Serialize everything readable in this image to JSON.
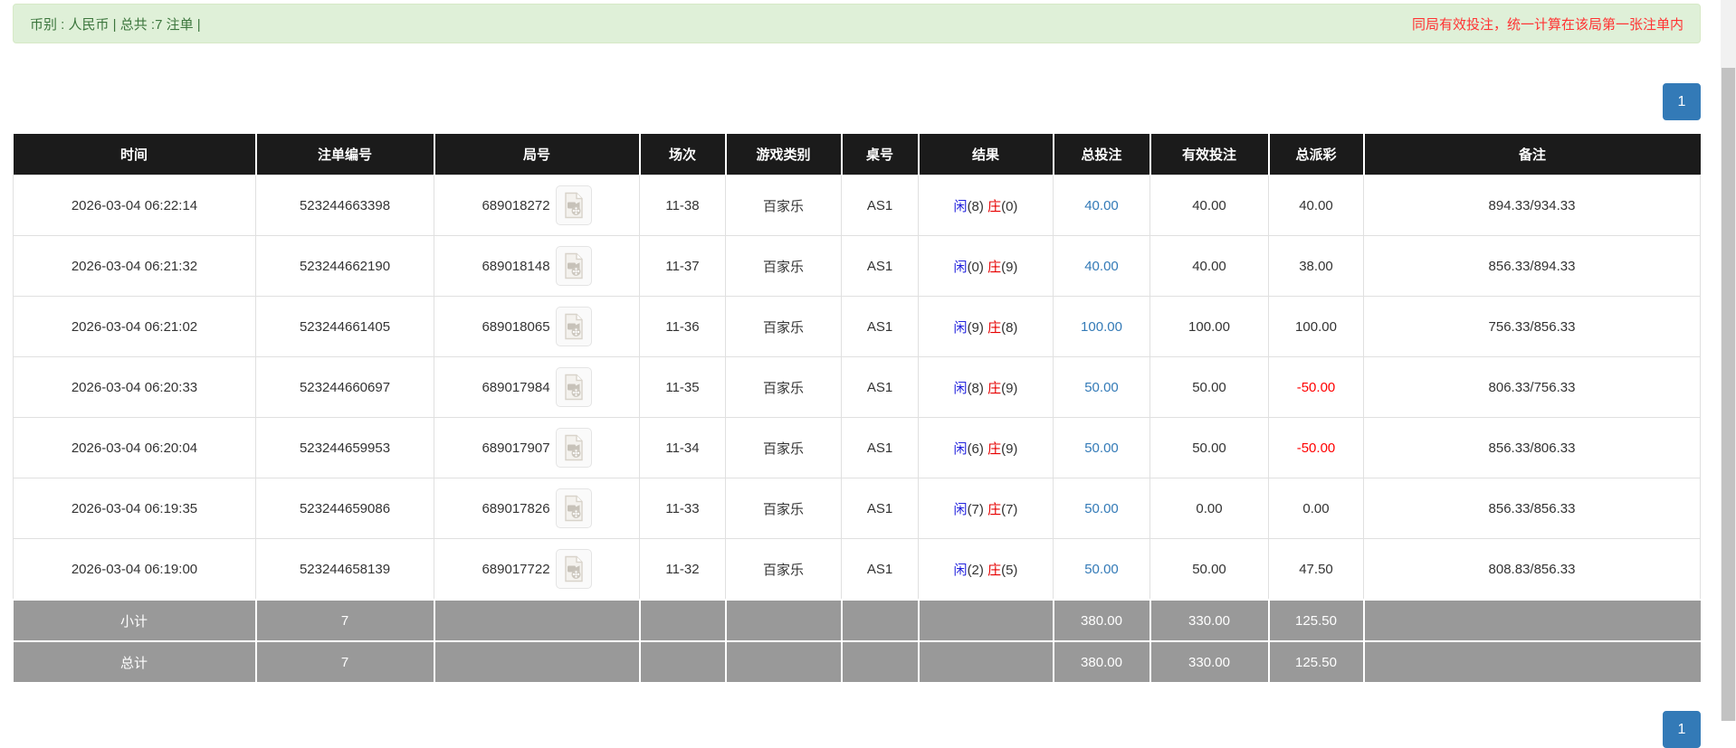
{
  "top_bar": {
    "summary": "币别 : 人民币 | 总共 :7 注单 |",
    "notice": "同局有效投注，统一计算在该局第一张注单内"
  },
  "pagination": {
    "page": "1"
  },
  "colors": {
    "accent_blue": "#337ab7",
    "player_blue": "#2323dd",
    "banker_red": "#e60000",
    "negative_red": "#ff0000",
    "header_bg": "#1b1b1b",
    "footer_bg": "#999999",
    "alert_bg": "#dff0d8",
    "alert_text": "#3c763d",
    "notice_red": "#ff3333"
  },
  "table": {
    "headers": [
      "时间",
      "注单编号",
      "局号",
      "场次",
      "游戏类别",
      "桌号",
      "结果",
      "总投注",
      "有效投注",
      "总派彩",
      "备注"
    ],
    "player_label": "闲",
    "banker_label": "庄",
    "video_icon": "video-document-icon",
    "rows": [
      {
        "time": "2026-03-04 06:22:14",
        "bet_id": "523244663398",
        "round": "689018272",
        "session": "11-38",
        "game": "百家乐",
        "table_no": "AS1",
        "player": "(8)",
        "banker": "(0)",
        "total_bet": "40.00",
        "valid_bet": "40.00",
        "payout": "40.00",
        "remark": "894.33/934.33"
      },
      {
        "time": "2026-03-04 06:21:32",
        "bet_id": "523244662190",
        "round": "689018148",
        "session": "11-37",
        "game": "百家乐",
        "table_no": "AS1",
        "player": "(0)",
        "banker": "(9)",
        "total_bet": "40.00",
        "valid_bet": "40.00",
        "payout": "38.00",
        "remark": "856.33/894.33"
      },
      {
        "time": "2026-03-04 06:21:02",
        "bet_id": "523244661405",
        "round": "689018065",
        "session": "11-36",
        "game": "百家乐",
        "table_no": "AS1",
        "player": "(9)",
        "banker": "(8)",
        "total_bet": "100.00",
        "valid_bet": "100.00",
        "payout": "100.00",
        "remark": "756.33/856.33"
      },
      {
        "time": "2026-03-04 06:20:33",
        "bet_id": "523244660697",
        "round": "689017984",
        "session": "11-35",
        "game": "百家乐",
        "table_no": "AS1",
        "player": "(8)",
        "banker": "(9)",
        "total_bet": "50.00",
        "valid_bet": "50.00",
        "payout": "-50.00",
        "remark": "806.33/756.33"
      },
      {
        "time": "2026-03-04 06:20:04",
        "bet_id": "523244659953",
        "round": "689017907",
        "session": "11-34",
        "game": "百家乐",
        "table_no": "AS1",
        "player": "(6)",
        "banker": "(9)",
        "total_bet": "50.00",
        "valid_bet": "50.00",
        "payout": "-50.00",
        "remark": "856.33/806.33"
      },
      {
        "time": "2026-03-04 06:19:35",
        "bet_id": "523244659086",
        "round": "689017826",
        "session": "11-33",
        "game": "百家乐",
        "table_no": "AS1",
        "player": "(7)",
        "banker": "(7)",
        "total_bet": "50.00",
        "valid_bet": "0.00",
        "payout": "0.00",
        "remark": "856.33/856.33"
      },
      {
        "time": "2026-03-04 06:19:00",
        "bet_id": "523244658139",
        "round": "689017722",
        "session": "11-32",
        "game": "百家乐",
        "table_no": "AS1",
        "player": "(2)",
        "banker": "(5)",
        "total_bet": "50.00",
        "valid_bet": "50.00",
        "payout": "47.50",
        "remark": "808.83/856.33"
      }
    ],
    "subtotal": {
      "label": "小计",
      "count": "7",
      "total_bet": "380.00",
      "valid_bet": "330.00",
      "payout": "125.50"
    },
    "total": {
      "label": "总计",
      "count": "7",
      "total_bet": "380.00",
      "valid_bet": "330.00",
      "payout": "125.50"
    }
  }
}
